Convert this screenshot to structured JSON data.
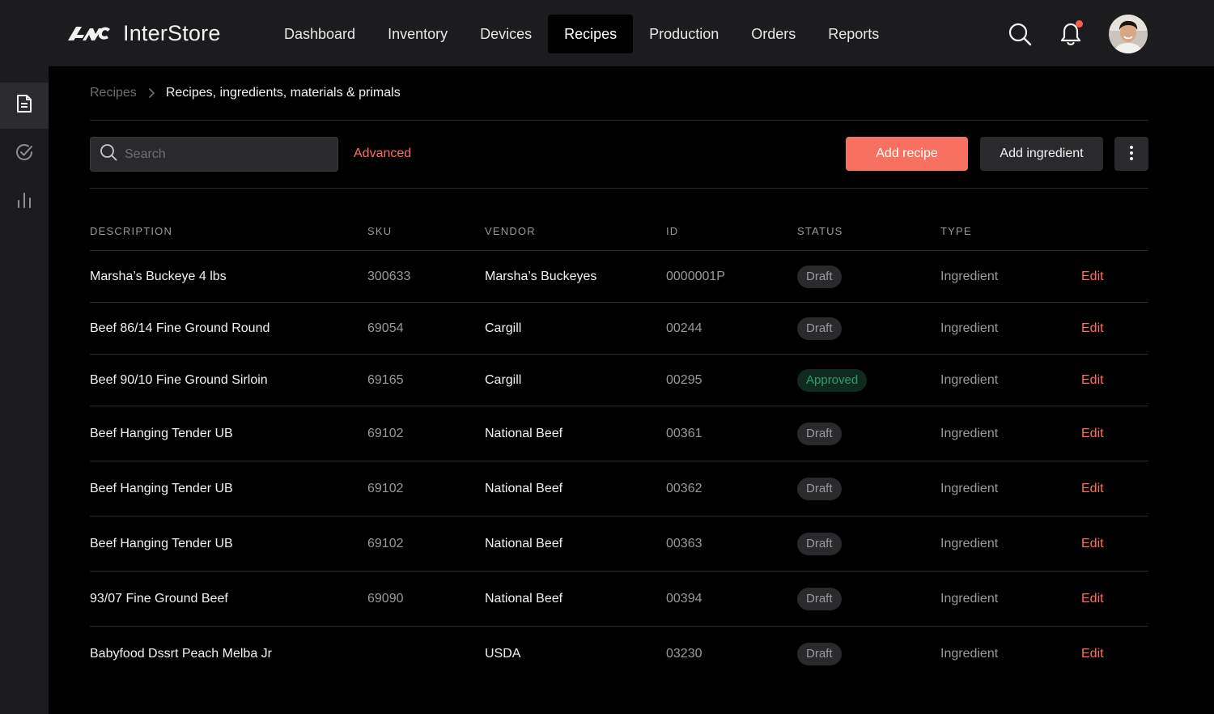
{
  "app": {
    "name": "InterStore",
    "logo_icon": "interstore-logo"
  },
  "nav": {
    "items": [
      {
        "label": "Dashboard"
      },
      {
        "label": "Inventory"
      },
      {
        "label": "Devices"
      },
      {
        "label": "Recipes",
        "active": true
      },
      {
        "label": "Production"
      },
      {
        "label": "Orders"
      },
      {
        "label": "Reports"
      }
    ]
  },
  "header_icons": {
    "search": "search-icon",
    "notifications": "bell-icon",
    "notification_dot_color": "#ff5c4a",
    "avatar": "user-avatar"
  },
  "sidebar": {
    "items": [
      {
        "icon": "document-icon",
        "active": true
      },
      {
        "icon": "check-circle-icon"
      },
      {
        "icon": "bar-chart-icon"
      }
    ]
  },
  "breadcrumb": {
    "root": "Recipes",
    "current": "Recipes, ingredients, materials & primals"
  },
  "toolbar": {
    "search_placeholder": "Search",
    "advanced_label": "Advanced",
    "add_recipe_label": "Add recipe",
    "add_ingredient_label": "Add ingredient",
    "more_icon": "more-vertical-icon"
  },
  "colors": {
    "accent": "#f87060",
    "link": "#ff6e5c",
    "approved_text": "#2f9e6a",
    "approved_bg": "#0f2a1e"
  },
  "table": {
    "headers": {
      "description": "DESCRIPTION",
      "sku": "SKU",
      "vendor": "VENDOR",
      "id": "ID",
      "status": "STATUS",
      "type": "TYPE"
    },
    "edit_label": "Edit",
    "rows": [
      {
        "description": "Marsha’s Buckeye 4 lbs",
        "sku": "300633",
        "vendor": "Marsha’s Buckeyes",
        "id": "0000001P",
        "status": "Draft",
        "type": "Ingredient"
      },
      {
        "description": "Beef 86/14 Fine Ground Round",
        "sku": "69054",
        "vendor": "Cargill",
        "id": "00244",
        "status": "Draft",
        "type": "Ingredient"
      },
      {
        "description": "Beef 90/10 Fine Ground Sirloin",
        "sku": "69165",
        "vendor": "Cargill",
        "id": "00295",
        "status": "Approved",
        "type": "Ingredient"
      },
      {
        "description": "Beef Hanging Tender UB",
        "sku": "69102",
        "vendor": "National Beef",
        "id": "00361",
        "status": "Draft",
        "type": "Ingredient"
      },
      {
        "description": "Beef Hanging Tender UB",
        "sku": "69102",
        "vendor": "National Beef",
        "id": "00362",
        "status": "Draft",
        "type": "Ingredient"
      },
      {
        "description": "Beef Hanging Tender UB",
        "sku": "69102",
        "vendor": "National Beef",
        "id": "00363",
        "status": "Draft",
        "type": "Ingredient"
      },
      {
        "description": "93/07 Fine Ground Beef",
        "sku": "69090",
        "vendor": "National Beef",
        "id": "00394",
        "status": "Draft",
        "type": "Ingredient"
      },
      {
        "description": "Babyfood Dssrt Peach Melba Jr",
        "sku": "",
        "vendor": "USDA",
        "id": "03230",
        "status": "Draft",
        "type": "Ingredient"
      }
    ]
  }
}
